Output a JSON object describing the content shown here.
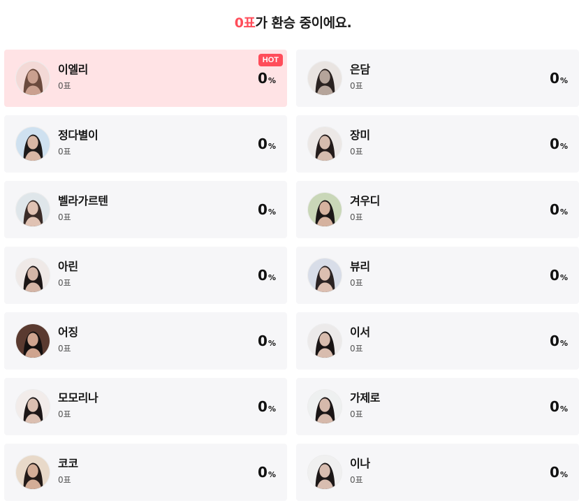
{
  "header": {
    "count": "0표",
    "suffix": "가 환승 중이에요."
  },
  "colors": {
    "accent": "#ff4d5a",
    "card_bg": "#f6f6f8",
    "hot_card_bg": "#ffe3e5"
  },
  "hot_badge": "HOT",
  "percent_unit": "%",
  "candidates": [
    {
      "name": "이엘리",
      "votes": "0표",
      "percent": "0",
      "hot": true
    },
    {
      "name": "은담",
      "votes": "0표",
      "percent": "0"
    },
    {
      "name": "정다별이",
      "votes": "0표",
      "percent": "0"
    },
    {
      "name": "장미",
      "votes": "0표",
      "percent": "0"
    },
    {
      "name": "벨라가르텐",
      "votes": "0표",
      "percent": "0"
    },
    {
      "name": "겨우디",
      "votes": "0표",
      "percent": "0"
    },
    {
      "name": "아린",
      "votes": "0표",
      "percent": "0"
    },
    {
      "name": "뷰리",
      "votes": "0표",
      "percent": "0"
    },
    {
      "name": "어징",
      "votes": "0표",
      "percent": "0"
    },
    {
      "name": "이서",
      "votes": "0표",
      "percent": "0"
    },
    {
      "name": "모모리나",
      "votes": "0표",
      "percent": "0"
    },
    {
      "name": "가제로",
      "votes": "0표",
      "percent": "0"
    },
    {
      "name": "코코",
      "votes": "0표",
      "percent": "0"
    },
    {
      "name": "이나",
      "votes": "0표",
      "percent": "0"
    }
  ]
}
